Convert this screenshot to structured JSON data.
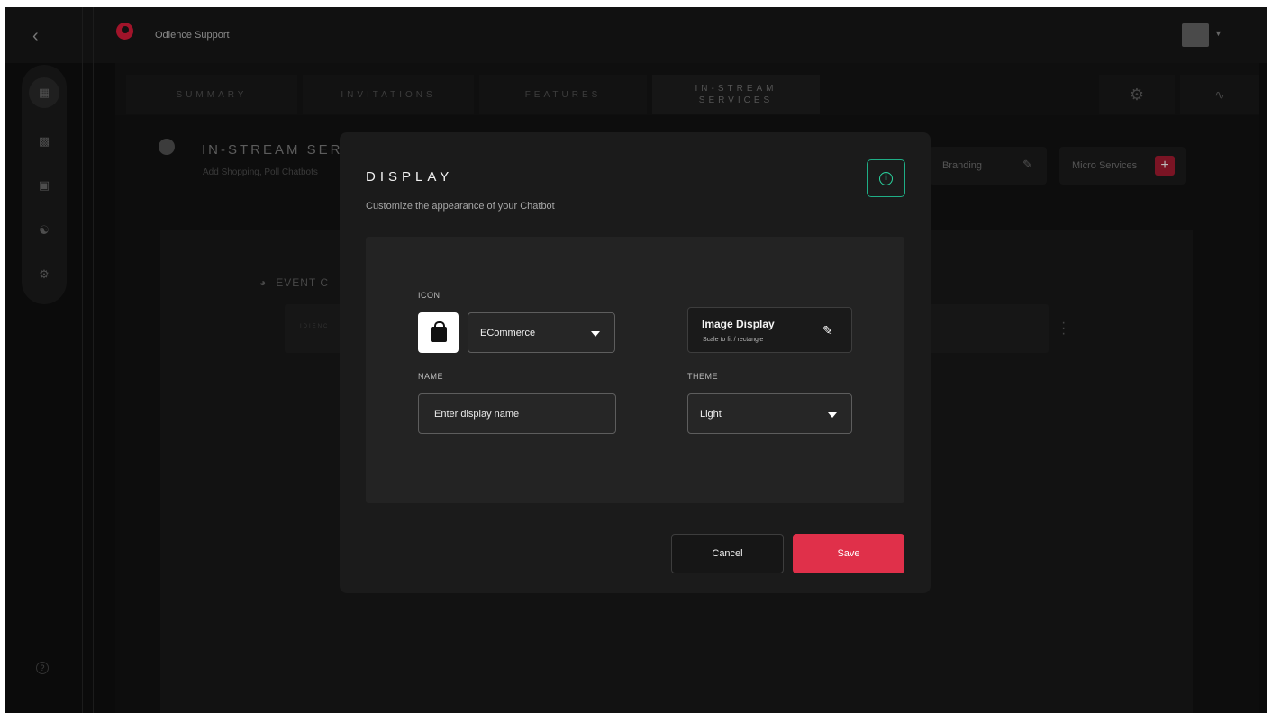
{
  "header": {
    "org_name": "Odience Support"
  },
  "tabs": [
    {
      "label": "SUMMARY"
    },
    {
      "label": "INVITATIONS"
    },
    {
      "label": "FEATURES"
    },
    {
      "label": "IN-STREAM SERVICES"
    }
  ],
  "page": {
    "title": "IN-STREAM SERV",
    "subtitle": "Add Shopping, Poll Chatbots",
    "branding_label": "Branding",
    "micro_services_label": "Micro Services",
    "plus": "+",
    "event_label": "EVENT C",
    "row_text": "IDIENC"
  },
  "modal": {
    "title": "DISPLAY",
    "subtitle": "Customize the appearance of your Chatbot",
    "info_glyph": "i",
    "icon_label": "ICON",
    "icon_select_value": "ECommerce",
    "image_display_title": "Image Display",
    "image_display_sub": "Scale to fit / rectangle",
    "name_label": "NAME",
    "name_placeholder": "Enter display name",
    "theme_label": "THEME",
    "theme_value": "Light",
    "cancel_label": "Cancel",
    "save_label": "Save"
  },
  "colors": {
    "accent_red": "#e0304a",
    "info_green": "#2ad49f",
    "modal_bg": "#1b1b1b"
  }
}
